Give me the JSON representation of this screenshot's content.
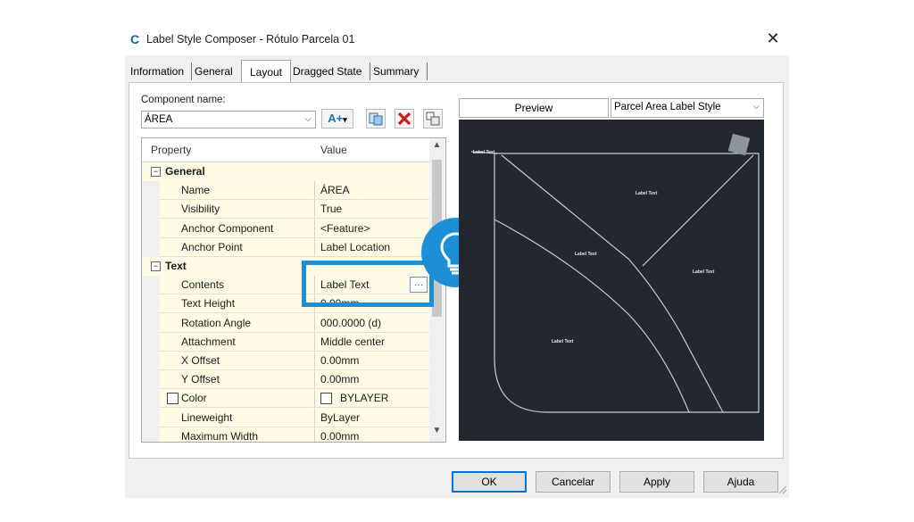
{
  "window": {
    "title": "Label Style Composer - Rótulo Parcela 01",
    "app_icon": "C",
    "close_icon": "✕"
  },
  "tabs": [
    {
      "label": "Information"
    },
    {
      "label": "General"
    },
    {
      "label": "Layout",
      "active": true
    },
    {
      "label": "Dragged State"
    },
    {
      "label": "Summary"
    }
  ],
  "component": {
    "name_label": "Component name:",
    "name_value": "ÁREA",
    "add_icon": "A+",
    "tools": [
      "add-component-icon",
      "copy-icon",
      "delete-icon",
      "reorder-icon"
    ]
  },
  "grid": {
    "headers": {
      "property": "Property",
      "value": "Value"
    },
    "rows": [
      {
        "type": "category",
        "label": "General",
        "toggle": "⊟"
      },
      {
        "type": "prop",
        "key": "Name",
        "value": "ÁREA"
      },
      {
        "type": "prop",
        "key": "Visibility",
        "value": "True"
      },
      {
        "type": "prop",
        "key": "Anchor Component",
        "value": "<Feature>"
      },
      {
        "type": "prop",
        "key": "Anchor Point",
        "value": "Label Location"
      },
      {
        "type": "category",
        "label": "Text",
        "toggle": "⊟"
      },
      {
        "type": "prop",
        "key": "Contents",
        "value": "Label Text",
        "has_ellipsis": true
      },
      {
        "type": "prop",
        "key": "Text Height",
        "value": "0.00mm"
      },
      {
        "type": "prop",
        "key": "Rotation Angle",
        "value": "000.0000 (d)"
      },
      {
        "type": "prop",
        "key": "Attachment",
        "value": "Middle center"
      },
      {
        "type": "prop",
        "key": "X Offset",
        "value": "0.00mm"
      },
      {
        "type": "prop",
        "key": "Y Offset",
        "value": "0.00mm"
      },
      {
        "type": "prop",
        "key": "Color",
        "value": "BYLAYER",
        "swatch": true
      },
      {
        "type": "prop",
        "key": "Lineweight",
        "value": "ByLayer"
      },
      {
        "type": "prop",
        "key": "Maximum Width",
        "value": "0.00mm"
      }
    ],
    "ellipsis": "…"
  },
  "preview": {
    "tab_label": "Preview",
    "style_value": "Parcel Area Label Style",
    "labels": [
      "Label Text",
      "Label Text",
      "Label Text",
      "Label Text",
      "Label Text"
    ]
  },
  "buttons": {
    "ok": "OK",
    "cancel": "Cancelar",
    "apply": "Apply",
    "help": "Ajuda"
  },
  "colors": {
    "highlight": "#1e8fd6",
    "preview_bg": "#232830",
    "grid_value_bg": "#fffbe5"
  }
}
